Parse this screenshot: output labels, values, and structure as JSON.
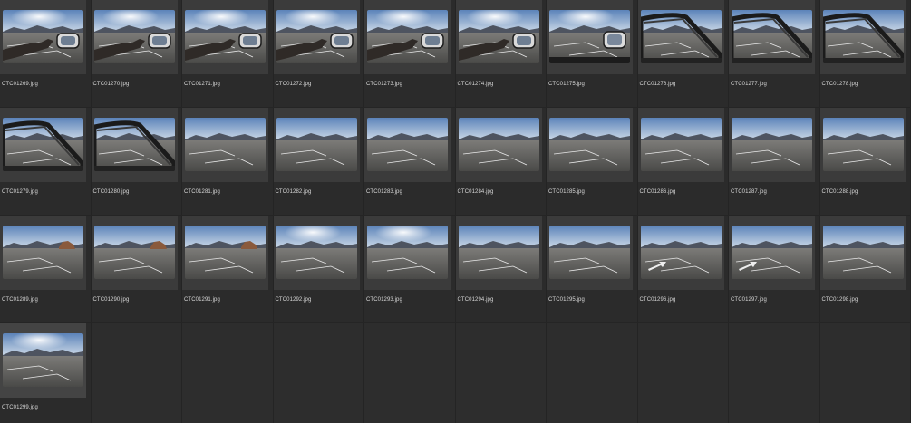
{
  "browser": {
    "files": [
      {
        "name": "CTC01269.jpg",
        "scene": "hand-mirror"
      },
      {
        "name": "CTC01270.jpg",
        "scene": "hand-mirror"
      },
      {
        "name": "CTC01271.jpg",
        "scene": "hand-mirror"
      },
      {
        "name": "CTC01272.jpg",
        "scene": "hand-mirror"
      },
      {
        "name": "CTC01273.jpg",
        "scene": "hand-mirror"
      },
      {
        "name": "CTC01274.jpg",
        "scene": "hand-mirror"
      },
      {
        "name": "CTC01275.jpg",
        "scene": "mirror"
      },
      {
        "name": "CTC01276.jpg",
        "scene": "door"
      },
      {
        "name": "CTC01277.jpg",
        "scene": "door"
      },
      {
        "name": "CTC01278.jpg",
        "scene": "door"
      },
      {
        "name": "CTC01279.jpg",
        "scene": "door"
      },
      {
        "name": "CTC01280.jpg",
        "scene": "door"
      },
      {
        "name": "CTC01281.jpg",
        "scene": "road"
      },
      {
        "name": "CTC01282.jpg",
        "scene": "road"
      },
      {
        "name": "CTC01283.jpg",
        "scene": "road"
      },
      {
        "name": "CTC01284.jpg",
        "scene": "road"
      },
      {
        "name": "CTC01285.jpg",
        "scene": "road"
      },
      {
        "name": "CTC01286.jpg",
        "scene": "road"
      },
      {
        "name": "CTC01287.jpg",
        "scene": "road"
      },
      {
        "name": "CTC01288.jpg",
        "scene": "road"
      },
      {
        "name": "CTC01289.jpg",
        "scene": "road-rocks"
      },
      {
        "name": "CTC01290.jpg",
        "scene": "road-rocks"
      },
      {
        "name": "CTC01291.jpg",
        "scene": "road-rocks"
      },
      {
        "name": "CTC01292.jpg",
        "scene": "road-sun"
      },
      {
        "name": "CTC01293.jpg",
        "scene": "road-sun"
      },
      {
        "name": "CTC01294.jpg",
        "scene": "road"
      },
      {
        "name": "CTC01295.jpg",
        "scene": "road"
      },
      {
        "name": "CTC01296.jpg",
        "scene": "arrow"
      },
      {
        "name": "CTC01297.jpg",
        "scene": "arrow"
      },
      {
        "name": "CTC01298.jpg",
        "scene": "road"
      },
      {
        "name": "CTC01299.jpg",
        "scene": "road-sun"
      }
    ],
    "selected_index": 30,
    "colors": {
      "background": "#2b2b2b",
      "tile": "#3b3b3b",
      "label": "#d8d8d8"
    },
    "icons": {
      "thumbnail": "photo-thumbnail-icon"
    }
  }
}
